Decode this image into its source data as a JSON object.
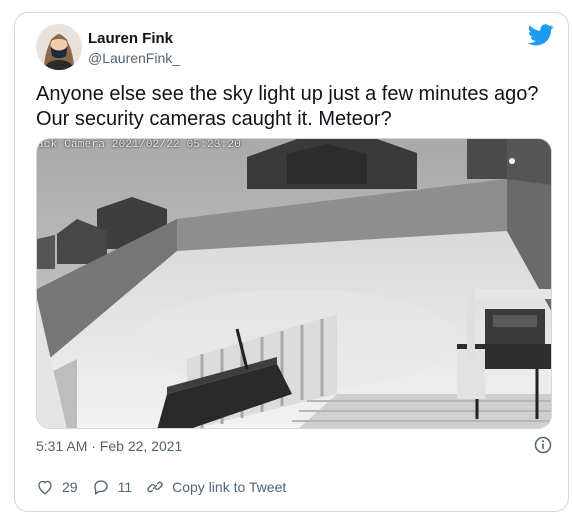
{
  "tweet": {
    "author_name": "Lauren Fink",
    "author_handle": "@LaurenFink_",
    "text": "Anyone else see the sky light up just a few minutes ago? Our security cameras caught it. Meteor?",
    "media_overlay": "ack Camera 2021/02/22 05:23:20",
    "timestamp": "5:31 AM · Feb 22, 2021",
    "likes": "29",
    "replies": "11",
    "copy_link_label": "Copy link to Tweet"
  },
  "colors": {
    "brand": "#1d9bf0",
    "secondary_text": "#536471",
    "border": "#cfd9de"
  },
  "icons": [
    "twitter-bird-icon",
    "info-icon",
    "heart-icon",
    "reply-icon",
    "link-icon"
  ]
}
